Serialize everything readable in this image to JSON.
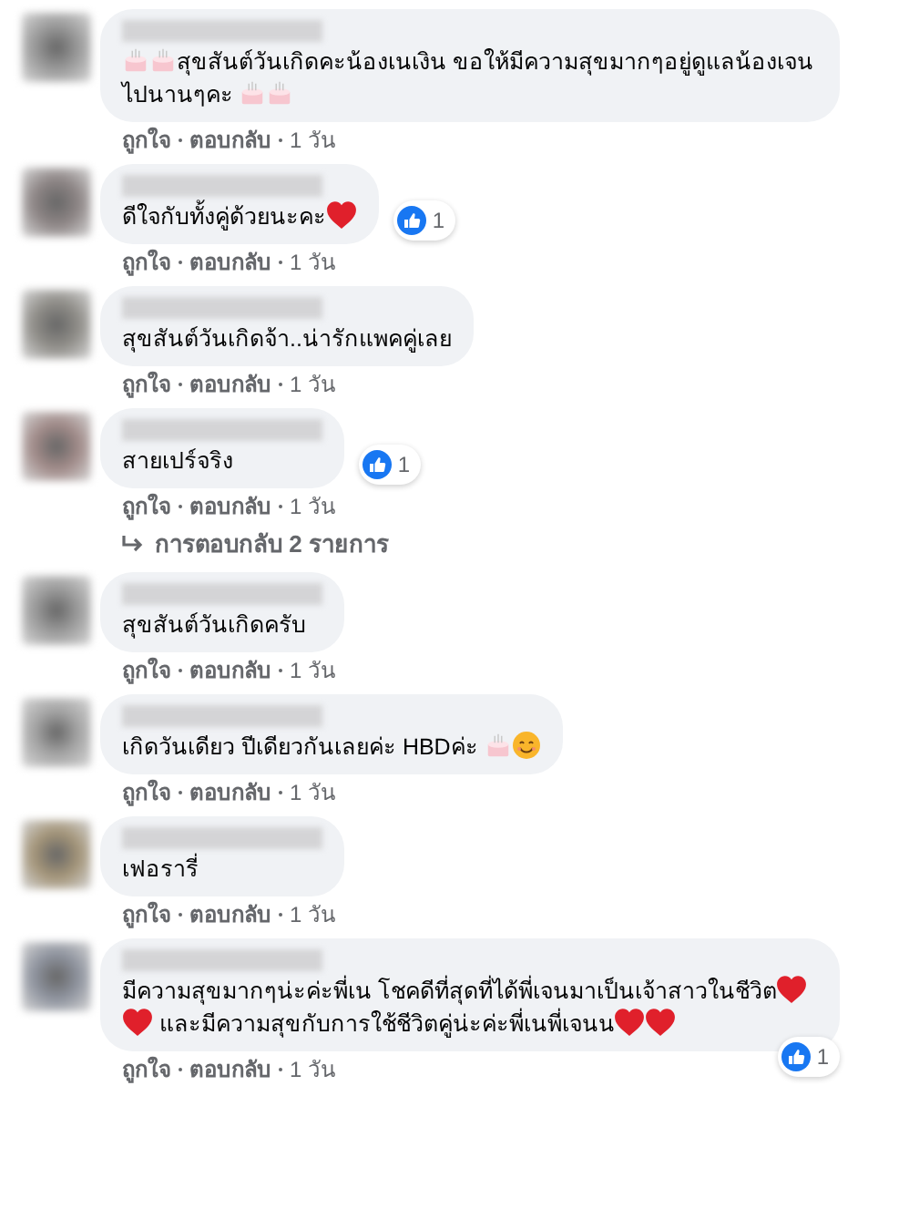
{
  "comments": [
    {
      "body": [
        {
          "kind": "cake"
        },
        {
          "kind": "cake"
        },
        {
          "kind": "text",
          "text": "สุขสันต์วันเกิดคะน้องเนเงิน ขอให้มีความสุขมากๆอยู่ดูแลน้องเจนไปนานๆคะ "
        },
        {
          "kind": "cake"
        },
        {
          "kind": "cake"
        }
      ],
      "like": "ถูกใจ",
      "reply": "ตอบกลับ",
      "time": "1 วัน"
    },
    {
      "body": [
        {
          "kind": "text",
          "text": "ดีใจกับทั้งคู่ด้วยนะคะ"
        },
        {
          "kind": "heart"
        }
      ],
      "reaction_count": "1",
      "like": "ถูกใจ",
      "reply": "ตอบกลับ",
      "time": "1 วัน"
    },
    {
      "body": [
        {
          "kind": "text",
          "text": "สุขสันต์วันเกิดจ้า..น่ารักแพคคู่เลย"
        }
      ],
      "like": "ถูกใจ",
      "reply": "ตอบกลับ",
      "time": "1 วัน"
    },
    {
      "body": [
        {
          "kind": "text",
          "text": "สายเปร์จริง"
        }
      ],
      "reaction_count": "1",
      "like": "ถูกใจ",
      "reply": "ตอบกลับ",
      "time": "1 วัน",
      "replies_link": "การตอบกลับ 2 รายการ"
    },
    {
      "body": [
        {
          "kind": "text",
          "text": "สุขสันต์วันเกิดครับ"
        }
      ],
      "like": "ถูกใจ",
      "reply": "ตอบกลับ",
      "time": "1 วัน"
    },
    {
      "body": [
        {
          "kind": "text",
          "text": "เกิดวันเดียว ปีเดียวกันเลยค่ะ HBDค่ะ "
        },
        {
          "kind": "cake"
        },
        {
          "kind": "smile"
        }
      ],
      "like": "ถูกใจ",
      "reply": "ตอบกลับ",
      "time": "1 วัน"
    },
    {
      "body": [
        {
          "kind": "text",
          "text": "เฟอรารี่"
        }
      ],
      "like": "ถูกใจ",
      "reply": "ตอบกลับ",
      "time": "1 วัน"
    },
    {
      "body": [
        {
          "kind": "text",
          "text": "มีความสุขมากๆน่ะค่ะพี่เน โชคดีที่สุดที่ได้พี่เจนมาเป็นเจ้าสาวในชีวิต"
        },
        {
          "kind": "heart"
        },
        {
          "kind": "heart"
        },
        {
          "kind": "text",
          "text": " และมีความสุขกับการใช้ชีวิตคู่น่ะค่ะพี่เนพี่เจนน"
        },
        {
          "kind": "heart"
        },
        {
          "kind": "heart"
        }
      ],
      "reaction_count": "1",
      "reaction_below": true,
      "like": "ถูกใจ",
      "reply": "ตอบกลับ",
      "time": "1 วัน"
    }
  ]
}
